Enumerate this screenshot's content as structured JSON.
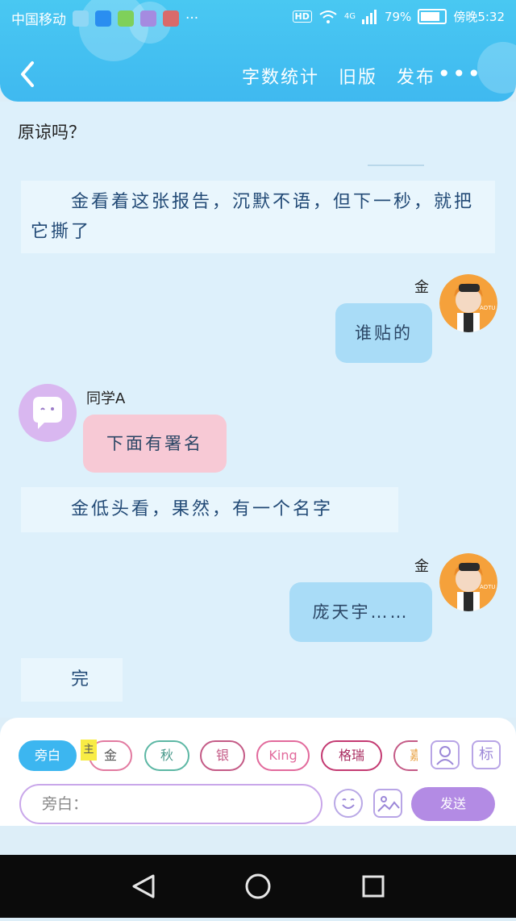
{
  "status_bar": {
    "carrier": "中国移动",
    "network": "4G",
    "hd": "HD",
    "battery": "79%",
    "time": "傍晚5:32",
    "more": "···"
  },
  "header": {
    "back": "‹",
    "actions": [
      "字数统计",
      "旧版",
      "发布"
    ],
    "more": "•••"
  },
  "chat": {
    "top_text": "原谅吗？",
    "narration_1": "　　金看着这张报告，沉默不语，但下一秒，就把它撕了",
    "msg_1": {
      "name": "金",
      "text": "谁贴的"
    },
    "msg_2": {
      "name": "同学A",
      "text": "下面有署名"
    },
    "narration_2": "　　金低头看，果然，有一个名字",
    "msg_3": {
      "name": "金",
      "text": "庞天宇……"
    },
    "narration_3": "　　完",
    "avatar_label": "AOTU"
  },
  "composer": {
    "main_tag": "主",
    "chips": [
      "旁白",
      "金",
      "秋",
      "银",
      "King",
      "格瑞",
      "嘉"
    ],
    "input_placeholder": "旁白：",
    "send": "发送",
    "tag_button": "标"
  },
  "colors": {
    "accent": "#3fb9f0",
    "send": "#b38be4",
    "right_bubble": "#a9dcf7",
    "left_bubble": "#f7c9d5"
  }
}
